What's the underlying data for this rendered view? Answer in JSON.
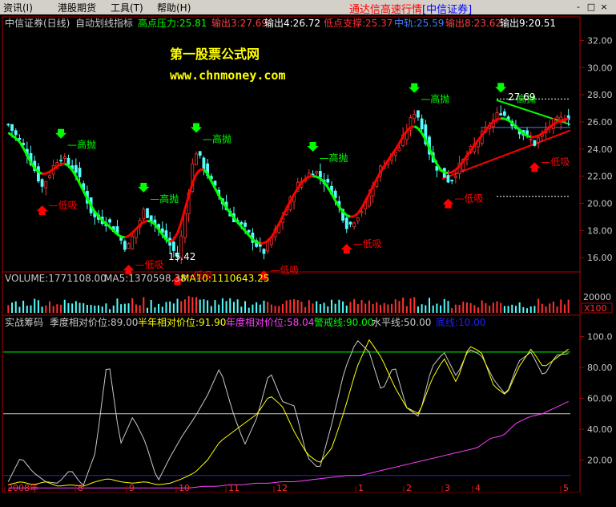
{
  "menu": {
    "items": [
      "资讯(I)",
      "港股期货",
      "工具(T)",
      "帮助(H)"
    ],
    "brand": "通达信高速行情",
    "brand_sub": "[中信证券]",
    "controls": [
      "-",
      "□",
      "×"
    ]
  },
  "colors": {
    "bg": "#000000",
    "frame": "#b00000",
    "up": "#ff3232",
    "down": "#54fcfc",
    "support": "#ff0000",
    "pressure": "#00ff00",
    "vol": "#ffff00",
    "white": "#ffffff",
    "magenta": "#ff00ff",
    "blue": "#0000ff"
  },
  "main": {
    "title": "中信证券(日线)",
    "indicator": "自动划线指标",
    "legend": [
      {
        "text": "高点压力:25.81",
        "color": "#00ff00"
      },
      {
        "text": "输出3:27.69",
        "color": "#ff4040"
      },
      {
        "text": "输出4:26.72",
        "color": "#ffffff"
      },
      {
        "text": "低点支撑:25.37",
        "color": "#ff3030"
      },
      {
        "text": "中轨:25.59",
        "color": "#4080ff"
      },
      {
        "text": "输出8:23.62",
        "color": "#ff4040"
      },
      {
        "text": "输出9:20.51",
        "color": "#ffffff"
      }
    ],
    "watermark_title": "第一股票公式网",
    "watermark_url": "www.chnmoney.com",
    "price_axis": [
      32,
      30,
      28,
      26,
      24,
      22,
      20,
      18,
      16
    ],
    "price_labels": [
      "32.00",
      "30.00",
      "28.00",
      "26.00",
      "24.00",
      "22.00",
      "20.00",
      "18.00",
      "16.00"
    ],
    "low_mark": "15.42",
    "high_mark": "27.69",
    "tag_high": "高抛",
    "tag_low": "低吸"
  },
  "volume": {
    "label": "VOLUME:1771108.00",
    "ma5": "MA5:1370598.38",
    "ma10": "MA10:1110643.25",
    "axis_value": "20000",
    "axis_unit": "X100"
  },
  "osc": {
    "name": "实战筹码",
    "legend": [
      {
        "text": "季度相对价位:89.00",
        "color": "#c8c8c8"
      },
      {
        "text": "半年相对价位:91.90",
        "color": "#ffff00"
      },
      {
        "text": "年度相对价位:58.04",
        "color": "#ff40ff"
      },
      {
        "text": "警戒线:90.00",
        "color": "#00ff00"
      },
      {
        "text": "水平线:50.00",
        "color": "#c8c8c8"
      },
      {
        "text": "底线:10.00",
        "color": "#2020ff"
      }
    ],
    "axis": [
      100,
      80,
      60,
      40,
      20
    ],
    "axis_labels": [
      "100.0",
      "80.00",
      "60.00",
      "40.00",
      "20.00"
    ]
  },
  "dates": [
    "2008年",
    "8",
    "9",
    "10",
    "11",
    "12",
    "1",
    "2",
    "3",
    "4",
    "5"
  ],
  "chart_data": {
    "type": "candlestick",
    "title": "中信证券(日线)",
    "price_range": [
      15,
      32.5
    ],
    "volume_axis_tick": "20000",
    "osc_range": [
      0,
      105
    ],
    "x_labels": [
      "2008年",
      "8",
      "9",
      "10",
      "11",
      "12",
      "1",
      "2",
      "3",
      "4",
      "5"
    ],
    "series": [
      {
        "name": "中信证券(日线)",
        "type": "candlestick",
        "approx_close_waypoints": [
          25.8,
          24,
          21.2,
          23.5,
          22.4,
          19,
          18.5,
          16.6,
          19.5,
          17.9,
          16,
          24,
          21.5,
          19.2,
          18,
          16.3,
          18.5,
          21.3,
          22.5,
          21.1,
          18.2,
          19.8,
          22.8,
          24,
          27,
          23,
          21.6,
          23.5,
          25.2,
          26.8,
          25.5,
          24.4,
          25.9,
          26.4
        ]
      },
      {
        "name": "季度相对价位",
        "type": "line",
        "color": "#c8c8c8",
        "waypoints": [
          6,
          22,
          12,
          6,
          5,
          14,
          3,
          25,
          88,
          30,
          48,
          32,
          6,
          22,
          36,
          48,
          62,
          80,
          52,
          30,
          48,
          78,
          58,
          55,
          22,
          14,
          44,
          78,
          98,
          90,
          64,
          82,
          54,
          48,
          80,
          90,
          74,
          92,
          88,
          72,
          62,
          84,
          90,
          74,
          88,
          89
        ]
      },
      {
        "name": "半年相对价位",
        "type": "line",
        "color": "#ffff00",
        "waypoints": [
          4,
          6,
          4,
          6,
          3,
          4,
          3,
          6,
          8,
          6,
          5,
          6,
          4,
          5,
          8,
          12,
          20,
          32,
          38,
          44,
          50,
          62,
          55,
          38,
          24,
          18,
          28,
          52,
          80,
          98,
          86,
          68,
          54,
          50,
          72,
          86,
          70,
          94,
          90,
          68,
          62,
          80,
          92,
          80,
          86,
          91.9
        ]
      },
      {
        "name": "年度相对价位",
        "type": "line",
        "color": "#ff40ff",
        "waypoints": [
          2,
          2,
          2,
          2,
          2,
          2,
          2,
          2,
          2,
          2,
          2,
          2,
          2,
          2,
          2,
          3,
          3,
          4,
          4,
          5,
          5,
          6,
          6,
          7,
          8,
          9,
          10,
          10,
          12,
          14,
          16,
          18,
          20,
          22,
          24,
          26,
          28,
          34,
          36,
          44,
          48,
          50,
          54,
          58
        ]
      }
    ],
    "overlays": {
      "高点压力": 25.81,
      "输出3": 27.69,
      "输出4": 26.72,
      "低点支撑": 25.37,
      "中轨": 25.59,
      "输出8": 23.62,
      "输出9": 20.51
    },
    "reference_lines": {
      "警戒线": 90,
      "水平线": 50,
      "底线": 10
    }
  }
}
